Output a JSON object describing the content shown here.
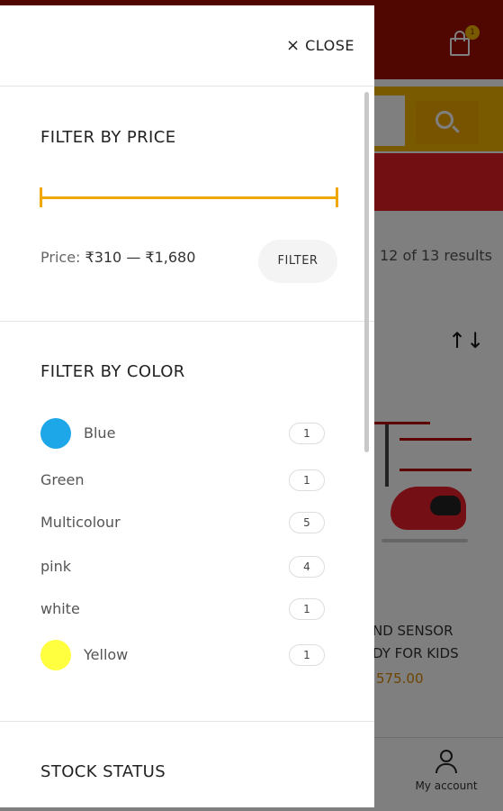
{
  "background": {
    "cart_count": "1",
    "results_text": "12 of 13 results",
    "sort_icon": "sort-arrows-icon",
    "sort_glyph": "↑↓",
    "product_title_line1": "ND SENSOR",
    "product_title_line2": "DY FOR KIDS",
    "product_price": "575.00",
    "account_label": "My account"
  },
  "drawer": {
    "close_label": "CLOSE",
    "close_icon": "×",
    "price_section": {
      "title": "FILTER BY PRICE",
      "price_label": "Price:",
      "min_price": "₹310",
      "separator": "—",
      "max_price": "₹1,680",
      "filter_button": "FILTER",
      "range_min_fraction": 0.0,
      "range_max_fraction": 1.0
    },
    "color_section": {
      "title": "FILTER BY COLOR",
      "items": [
        {
          "label": "Blue",
          "count": "1",
          "swatch": "#1ea7e8"
        },
        {
          "label": "Green",
          "count": "1",
          "swatch": ""
        },
        {
          "label": "Multicolour",
          "count": "5",
          "swatch": ""
        },
        {
          "label": "pink",
          "count": "4",
          "swatch": ""
        },
        {
          "label": "white",
          "count": "1",
          "swatch": ""
        },
        {
          "label": "Yellow",
          "count": "1",
          "swatch": "#ffff40"
        }
      ]
    },
    "stock_section": {
      "title": "STOCK STATUS"
    }
  },
  "colors": {
    "accent": "#f0a800",
    "header_red": "#a00f05",
    "promo_red": "#e21f26"
  }
}
